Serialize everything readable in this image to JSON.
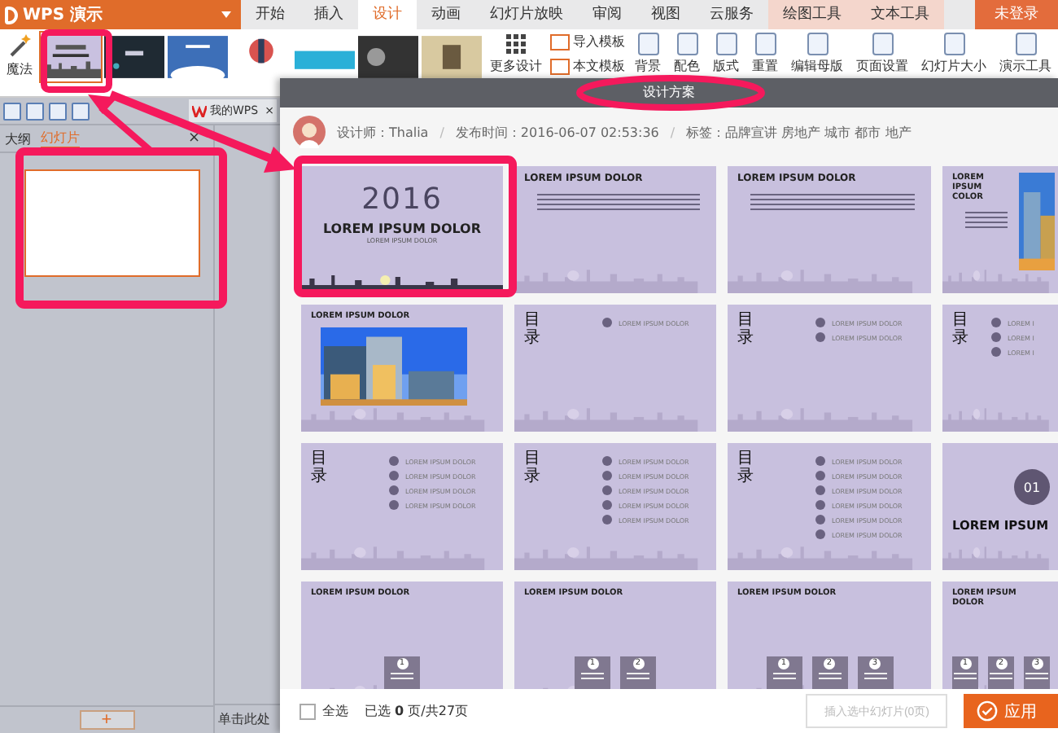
{
  "app": {
    "title": "WPS 演示",
    "login": "未登录"
  },
  "menu_tabs": [
    {
      "label": "开始",
      "selected": false,
      "kind": "normal"
    },
    {
      "label": "插入",
      "selected": false,
      "kind": "normal"
    },
    {
      "label": "设计",
      "selected": true,
      "kind": "normal"
    },
    {
      "label": "动画",
      "selected": false,
      "kind": "normal"
    },
    {
      "label": "幻灯片放映",
      "selected": false,
      "kind": "normal"
    },
    {
      "label": "审阅",
      "selected": false,
      "kind": "normal"
    },
    {
      "label": "视图",
      "selected": false,
      "kind": "normal"
    },
    {
      "label": "云服务",
      "selected": false,
      "kind": "normal"
    },
    {
      "label": "绘图工具",
      "selected": false,
      "kind": "context"
    },
    {
      "label": "文本工具",
      "selected": false,
      "kind": "context"
    }
  ],
  "ribbon": {
    "magic": "魔法",
    "more": "更多设计",
    "tools": [
      "导入模板",
      "本文模板"
    ],
    "buttons": [
      "背景",
      "配色",
      "版式",
      "重置",
      "编辑母版",
      "页面设置",
      "幻灯片大小",
      "演示工具"
    ]
  },
  "doc_tab": {
    "label": "我的WPS",
    "close": "×"
  },
  "panel_tabs": [
    {
      "label": "大纲",
      "selected": false
    },
    {
      "label": "幻灯片",
      "selected": true
    }
  ],
  "panel_close": "×",
  "add_button": "+",
  "status_text": "单击此处",
  "dialog": {
    "title": "设计方案",
    "info": [
      {
        "kind": "text",
        "text": "设计师：Thalia"
      },
      {
        "kind": "separator",
        "text": "/"
      },
      {
        "kind": "text",
        "text": "发布时间：2016-06-07 02:53:36"
      },
      {
        "kind": "separator",
        "text": "/"
      },
      {
        "kind": "text",
        "text": "标签：品牌宣讲 房地产 城市 都市 地产"
      }
    ],
    "slides": [
      {
        "kind": "title",
        "year": "2016",
        "title": "LOREM IPSUM DOLOR",
        "subtitle": "LOREM IPSUM DOLOR"
      },
      {
        "kind": "text",
        "title": "LOREM IPSUM DOLOR"
      },
      {
        "kind": "text",
        "title": "LOREM IPSUM DOLOR"
      },
      {
        "kind": "photo-side",
        "title": "LOREM IPSUM COLOR"
      },
      {
        "title": "LOREM IPSUM DOLOR"
      },
      {
        "kind": "toc",
        "heading": "目录",
        "items": [
          "LOREM IPSUM DOLOR"
        ]
      },
      {
        "kind": "toc",
        "heading": "目录",
        "items": [
          "LOREM IPSUM DOLOR",
          "LOREM IPSUM DOLOR"
        ]
      },
      {
        "kind": "toc",
        "heading": "目录",
        "items": [
          "LOREM I",
          "LOREM I",
          "LOREM I"
        ]
      },
      {
        "kind": "toc",
        "heading": "目录",
        "items": [
          "LOREM IPSUM DOLOR",
          "LOREM IPSUM DOLOR",
          "LOREM IPSUM DOLOR",
          "LOREM IPSUM DOLOR"
        ]
      },
      {
        "kind": "toc",
        "heading": "目录",
        "items": [
          "LOREM IPSUM DOLOR",
          "LOREM IPSUM DOLOR",
          "LOREM IPSUM DOLOR",
          "LOREM IPSUM DOLOR",
          "LOREM IPSUM DOLOR"
        ]
      },
      {
        "kind": "toc",
        "heading": "目录",
        "items": [
          "LOREM IPSUM DOLOR",
          "LOREM IPSUM DOLOR",
          "LOREM IPSUM DOLOR",
          "LOREM IPSUM DOLOR",
          "LOREM IPSUM DOLOR",
          "LOREM IPSUM DOLOR"
        ]
      },
      {
        "kind": "section",
        "number": "01",
        "title": "LOREM IPSUM"
      },
      {
        "kind": "steps",
        "title": "LOREM IPSUM DOLOR",
        "steps": [
          "1"
        ]
      },
      {
        "kind": "steps",
        "title": "LOREM IPSUM DOLOR",
        "steps": [
          "1",
          "2"
        ]
      },
      {
        "kind": "steps",
        "title": "LOREM IPSUM DOLOR",
        "steps": [
          "1",
          "2",
          "3"
        ]
      },
      {
        "kind": "steps",
        "title": "LOREM IPSUM DOLOR",
        "steps": [
          "1",
          "2",
          "3"
        ]
      }
    ],
    "select_all": {
      "label": "全选",
      "checked": false
    },
    "count": "已选 **0** 页/共27页",
    "insert_button": {
      "label": "插入选中幻灯片(0页)",
      "disabled": true
    },
    "apply_button": "应用"
  }
}
